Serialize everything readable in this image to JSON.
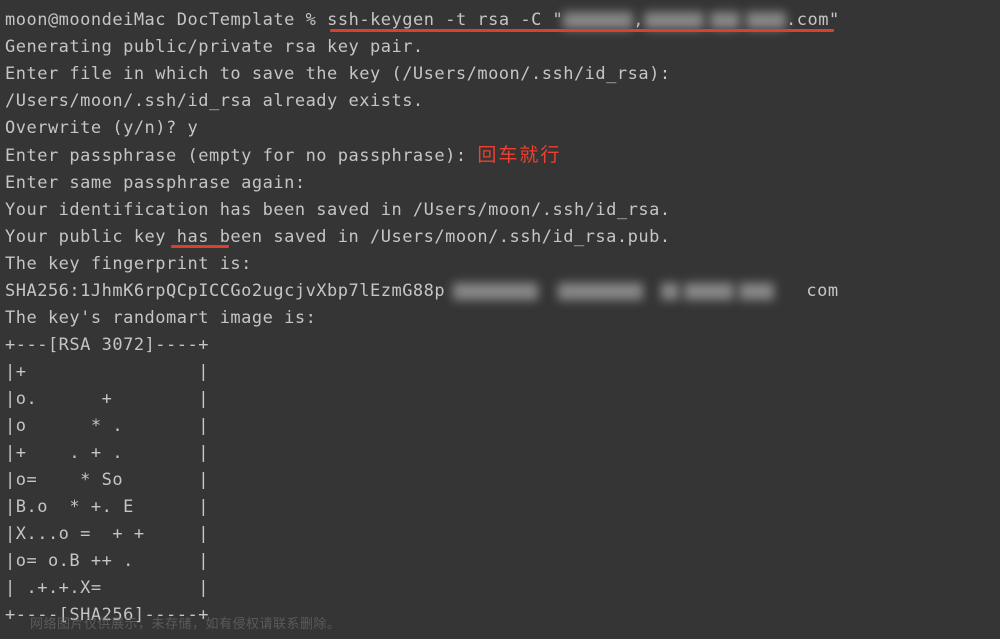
{
  "prompt": {
    "user_host": "moon@moondeiMac",
    "dir": "DocTemplate",
    "symbol": "%",
    "cmd_part1": "ssh-keygen -t rsa -C \"",
    "cmd_part2": ".com\""
  },
  "lines": {
    "l1": "Generating public/private rsa key pair.",
    "l2": "Enter file in which to save the key (/Users/moon/.ssh/id_rsa):",
    "l3": "/Users/moon/.ssh/id_rsa already exists.",
    "l4": "Overwrite (y/n)? y",
    "l5a": "Enter passphrase (empty for no passphrase): ",
    "l5_annotation": "回车就行",
    "l6": "Enter same passphrase again:",
    "l7": "Your identification has been saved in /Users/moon/.ssh/id_rsa.",
    "l8": "Your public key has been saved in /Users/moon/.ssh/id_rsa.pub.",
    "l9": "The key fingerprint is:",
    "l10a": "SHA256:1JhmK6rpQCpICCGo2ugcjvXbp7lEzmG88p",
    "l10b": "com",
    "l11": "The key's randomart image is:",
    "art0": "+---[RSA 3072]----+",
    "art1": "|+                |",
    "art2": "|o.      +        |",
    "art3": "|o      * .       |",
    "art4": "|+    . + .       |",
    "art5": "|o=    * So       |",
    "art6": "|B.o  * +. E      |",
    "art7": "|X...o =  + +     |",
    "art8": "|o= o.B ++ .      |",
    "art9": "| .+.+.X=         |",
    "art10": "+----[SHA256]-----+"
  },
  "watermark": "网络图片仅供展示，未存储，如有侵权请联系删除。"
}
